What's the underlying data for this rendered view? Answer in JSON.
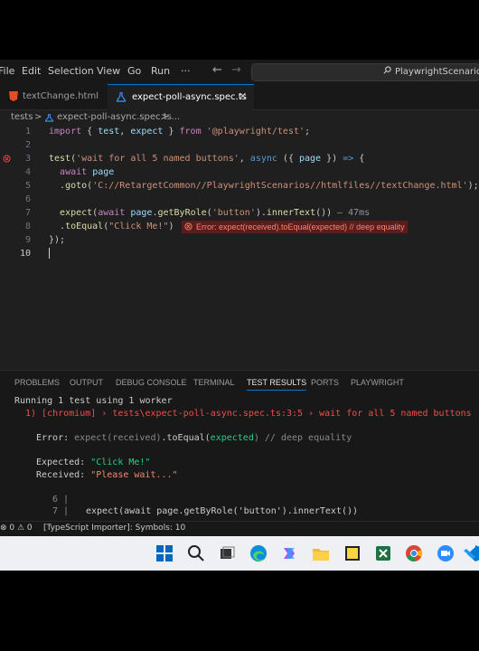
{
  "menu": {
    "items": [
      "File",
      "Edit",
      "Selection",
      "View",
      "Go",
      "Run"
    ],
    "more": "···",
    "back": "←",
    "forward": "→",
    "search_text": "PlaywrightScenarios"
  },
  "tabs": [
    {
      "label": "textChange.html",
      "active": false
    },
    {
      "label": "expect-poll-async.spec.ts",
      "active": true,
      "close": "✕"
    }
  ],
  "breadcrumb": {
    "folder": "tests",
    "sep": ">",
    "file": "expect-poll-async.spec.ts",
    "sep2": "> ..."
  },
  "editor": {
    "line_numbers": [
      "1",
      "2",
      "3",
      "4",
      "5",
      "6",
      "7",
      "8",
      "9",
      "10"
    ],
    "timing": "— 47ms",
    "error_message": "Error: expect(received).toEqual(expected) // deep equality"
  },
  "panel": {
    "tabs": [
      "PROBLEMS",
      "OUTPUT",
      "DEBUG CONSOLE",
      "TERMINAL",
      "TEST RESULTS",
      "PORTS",
      "PLAYWRIGHT"
    ],
    "active_tab": "TEST RESULTS",
    "running_line": "Running 1 test using 1 worker",
    "fail_line": "1) [chromium] › tests\\expect-poll-async.spec.ts:3:5 › wait for all 5 named buttons",
    "error_line_prefix": "Error: ",
    "error_line_expect": "expect(received)",
    "error_line_mid": ".toEqual(",
    "error_line_arg": "expected",
    "error_line_suffix": ") // deep equality",
    "expected_label": "Expected: ",
    "expected_value": "\"Click Me!\"",
    "received_label": "Received: ",
    "received_value": "\"Please wait...\"",
    "snippet_ln6": "6 |",
    "snippet_ln7": "7 |",
    "snippet_code": "expect(await page.getByRole('button').innerText())"
  },
  "status": {
    "problems": "⊗ 0 ⚠ 0",
    "importer": "[TypeScript Importer]: Symbols: 10"
  },
  "colors": {
    "accent": "#0078d4",
    "error": "#f14c4c",
    "editor_bg": "#1f1f1f"
  }
}
